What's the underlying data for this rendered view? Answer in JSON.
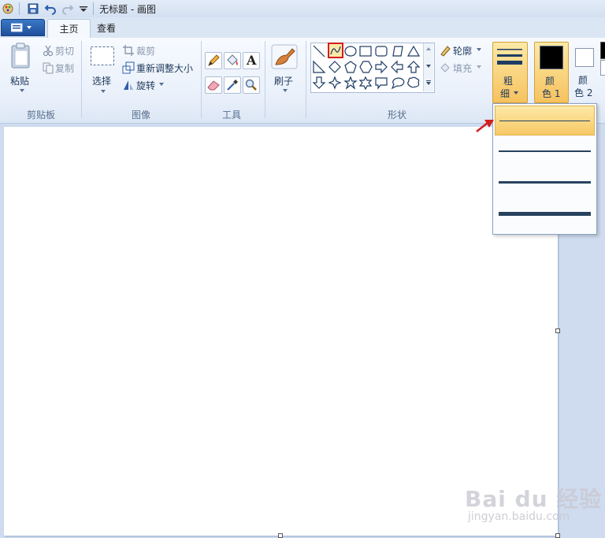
{
  "window": {
    "title": "无标题 - 画图"
  },
  "tabs": [
    {
      "label": "主页"
    },
    {
      "label": "查看"
    }
  ],
  "clipboard": {
    "paste_label": "粘贴",
    "cut_label": "剪切",
    "copy_label": "复制",
    "group_label": "剪贴板"
  },
  "image": {
    "select_label": "选择",
    "crop_label": "裁剪",
    "resize_label": "重新调整大小",
    "rotate_label": "旋转",
    "group_label": "图像"
  },
  "tools": {
    "group_label": "工具",
    "text_glyph": "A"
  },
  "brushes": {
    "label": "刷子"
  },
  "shapes": {
    "group_label": "形状",
    "outline_label": "轮廓",
    "fill_label": "填充"
  },
  "size": {
    "label_line1": "粗",
    "label_line2": "细"
  },
  "colors": {
    "color1_line1": "颜",
    "color1_line2": "色 1",
    "color2_line1": "颜",
    "color2_line2": "色 2",
    "color1": "#000000",
    "color2": "#ffffff",
    "accent": "#d31e1e"
  },
  "watermark": {
    "text": "Bai du 经验",
    "url": "jingyan.baidu.com"
  }
}
